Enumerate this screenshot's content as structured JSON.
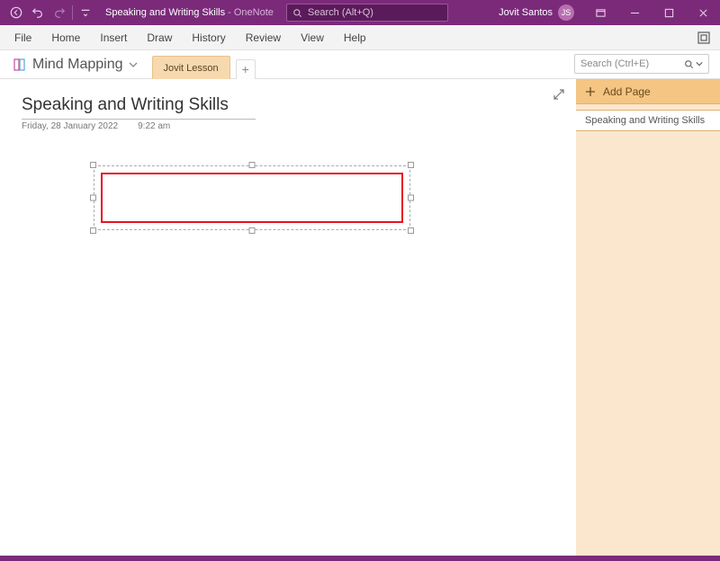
{
  "titlebar": {
    "doc_title": "Speaking and Writing Skills",
    "app_suffix": " - OneNote",
    "search_placeholder": "Search (Alt+Q)",
    "username": "Jovit Santos",
    "avatar_initials": "JS"
  },
  "menubar": {
    "items": [
      "File",
      "Home",
      "Insert",
      "Draw",
      "History",
      "Review",
      "View",
      "Help"
    ]
  },
  "tabrow": {
    "notebook_name": "Mind Mapping",
    "section_tab": "Jovit Lesson",
    "search_placeholder": "Search (Ctrl+E)"
  },
  "page": {
    "title": "Speaking and Writing Skills",
    "date": "Friday, 28 January 2022",
    "time": "9:22 am"
  },
  "sidepanel": {
    "add_page_label": "Add Page",
    "pages": [
      "Speaking and Writing Skills"
    ]
  }
}
